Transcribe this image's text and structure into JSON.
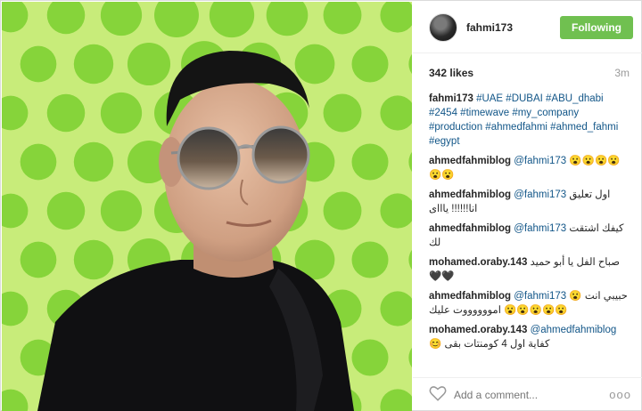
{
  "post": {
    "username": "fahmi173",
    "follow_label": "Following",
    "likes": "342 likes",
    "time": "3m",
    "caption": {
      "user": "fahmi173",
      "hashtags_line1": "#UAE #DUBAI #ABU_dhabi",
      "hashtags_line2": "#2454 #timewave #my_company",
      "hashtags_line3": "#production #ahmedfahmi #ahmed_fahmi",
      "hashtags_line4": "#egypt"
    }
  },
  "comments": [
    {
      "user": "ahmedfahmiblog",
      "mention": "@fahmi173",
      "text": "😮😮😮😮😮😮"
    },
    {
      "user": "ahmedfahmiblog",
      "mention": "@fahmi173",
      "text": "اول تعليق انا!!!!!! ياااى"
    },
    {
      "user": "ahmedfahmiblog",
      "mention": "@fahmi173",
      "text": "كيفك اشتقت لك"
    },
    {
      "user": "mohamed.oraby.143",
      "mention": "",
      "text": "صباح الفل يا أبو حميد 🖤🖤"
    },
    {
      "user": "ahmedfahmiblog",
      "mention": "@fahmi173",
      "text": "حبيبي انت 😮😮😮😮😮😮 امووووووت عليك"
    },
    {
      "user": "mohamed.oraby.143",
      "mention": "@ahmedfahmiblog",
      "text": "كفاية اول 4 كومنتات بقى 😊"
    }
  ],
  "footer": {
    "placeholder": "Add a comment...",
    "more": "ooo"
  },
  "icons": {
    "heart": "heart-outline-icon",
    "more": "more-options-icon"
  },
  "colors": {
    "follow_button": "#70c050",
    "link": "#125688",
    "photo_background": "#c8ec7a",
    "dots": "#86d43a"
  }
}
